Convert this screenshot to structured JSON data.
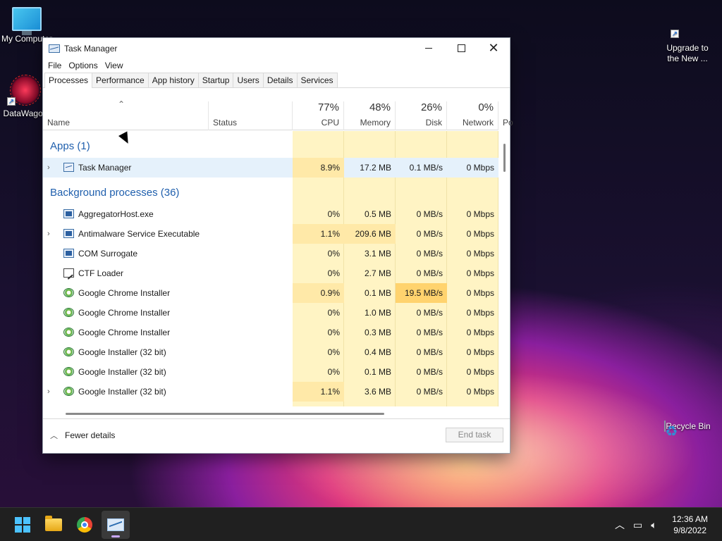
{
  "desktop": {
    "icons": {
      "my_computer": "My Computer",
      "datawagon": "DataWagon",
      "upgrade_line1": "Upgrade to",
      "upgrade_line2": "the New ...",
      "recycle_bin": "Recycle Bin"
    }
  },
  "window": {
    "title": "Task Manager",
    "menu": [
      "File",
      "Options",
      "View"
    ],
    "tabs": [
      "Processes",
      "Performance",
      "App history",
      "Startup",
      "Users",
      "Details",
      "Services"
    ],
    "active_tab": "Processes",
    "columns": {
      "name": "Name",
      "status": "Status",
      "cpu_pct": "77%",
      "cpu": "CPU",
      "memory_pct": "48%",
      "memory": "Memory",
      "disk_pct": "26%",
      "disk": "Disk",
      "network_pct": "0%",
      "network": "Network",
      "power": "Po"
    },
    "groups": {
      "apps": "Apps (1)",
      "background": "Background processes (36)"
    },
    "rows": [
      {
        "name": "Task Manager",
        "cpu": "8.9%",
        "memory": "17.2 MB",
        "disk": "0.1 MB/s",
        "network": "0 Mbps",
        "expandable": true
      },
      {
        "name": "AggregatorHost.exe",
        "cpu": "0%",
        "memory": "0.5 MB",
        "disk": "0 MB/s",
        "network": "0 Mbps",
        "expandable": false
      },
      {
        "name": "Antimalware Service Executable",
        "cpu": "1.1%",
        "memory": "209.6 MB",
        "disk": "0 MB/s",
        "network": "0 Mbps",
        "expandable": true
      },
      {
        "name": "COM Surrogate",
        "cpu": "0%",
        "memory": "3.1 MB",
        "disk": "0 MB/s",
        "network": "0 Mbps",
        "expandable": false
      },
      {
        "name": "CTF Loader",
        "cpu": "0%",
        "memory": "2.7 MB",
        "disk": "0 MB/s",
        "network": "0 Mbps",
        "expandable": false
      },
      {
        "name": "Google Chrome Installer",
        "cpu": "0.9%",
        "memory": "0.1 MB",
        "disk": "19.5 MB/s",
        "network": "0 Mbps",
        "expandable": false
      },
      {
        "name": "Google Chrome Installer",
        "cpu": "0%",
        "memory": "1.0 MB",
        "disk": "0 MB/s",
        "network": "0 Mbps",
        "expandable": false
      },
      {
        "name": "Google Chrome Installer",
        "cpu": "0%",
        "memory": "0.3 MB",
        "disk": "0 MB/s",
        "network": "0 Mbps",
        "expandable": false
      },
      {
        "name": "Google Installer (32 bit)",
        "cpu": "0%",
        "memory": "0.4 MB",
        "disk": "0 MB/s",
        "network": "0 Mbps",
        "expandable": false
      },
      {
        "name": "Google Installer (32 bit)",
        "cpu": "0%",
        "memory": "0.1 MB",
        "disk": "0 MB/s",
        "network": "0 Mbps",
        "expandable": false
      },
      {
        "name": "Google Installer (32 bit)",
        "cpu": "1.1%",
        "memory": "3.6 MB",
        "disk": "0 MB/s",
        "network": "0 Mbps",
        "expandable": true
      }
    ],
    "footer": {
      "fewer_details": "Fewer details",
      "end_task": "End task"
    }
  },
  "taskbar": {
    "time": "12:36 AM",
    "date": "9/8/2022"
  },
  "colors": {
    "heat_light": "#fff4c4",
    "heat_medium": "#ffe9a8",
    "heat_high": "#ffd36e",
    "group_title": "#1f5fad",
    "selected_row": "#e5f1fb"
  }
}
